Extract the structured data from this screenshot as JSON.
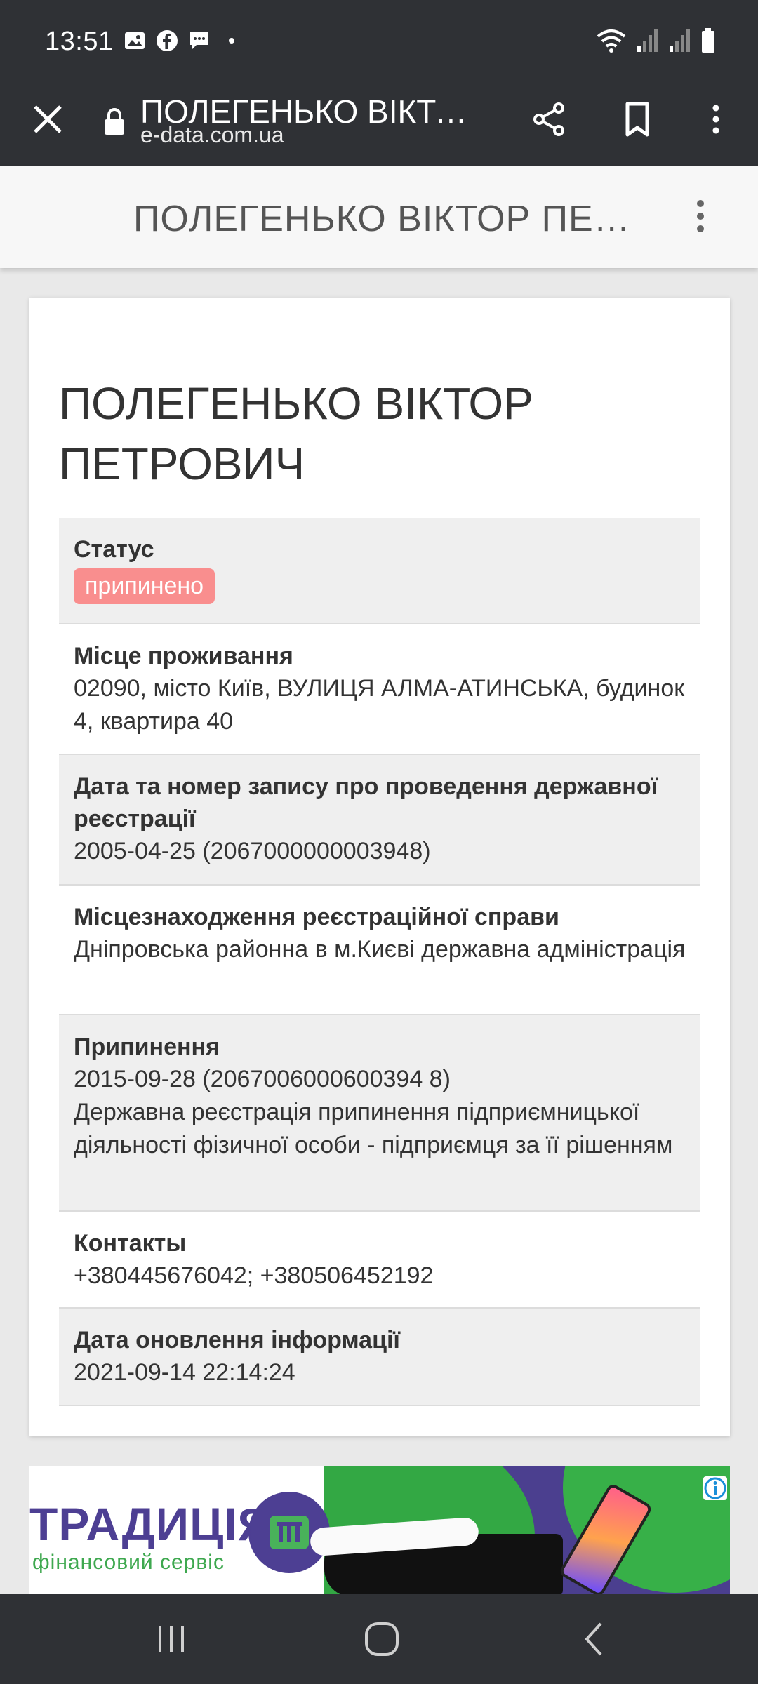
{
  "status_bar": {
    "time": "13:51",
    "left_icons": [
      "image-icon",
      "facebook-icon",
      "message-icon",
      "dot-icon"
    ],
    "right_icons": [
      "wifi-icon",
      "signal-icon",
      "signal-icon",
      "battery-icon"
    ]
  },
  "browser": {
    "page_title": "ПОЛЕГЕНЬКО ВІКТО...",
    "domain": "e-data.com.ua"
  },
  "header": {
    "title": "ПОЛЕГЕНЬКО ВІКТОР ПЕТ..."
  },
  "card": {
    "name_line1": "ПОЛЕГЕНЬКО ВІКТОР",
    "name_line2": "ПЕТРОВИЧ",
    "rows": [
      {
        "label": "Статус",
        "badge": "припинено"
      },
      {
        "label": "Місце проживання",
        "value": "02090, місто Київ, ВУЛИЦЯ АЛМА-АТИНСЬКА, будинок 4, квартира 40"
      },
      {
        "label": "Дата та номер запису про проведення державної реєстрації",
        "value": "2005-04-25 (2067000000003948)"
      },
      {
        "label": "Місцезнаходження реєстраційної справи",
        "value": "Дніпровська районна в м.Києві державна адміністрація"
      },
      {
        "label": "Припинення",
        "value": "2015-09-28 (2067006000600394 8)",
        "value2": "Державна реєстрація припинення підприємницької діяльності фізичної особи - підприємця за її рішенням"
      },
      {
        "label": "Контакты",
        "value": "+380445676042; +380506452192"
      },
      {
        "label": "Дата оновлення інформації",
        "value": "2021-09-14 22:14:24"
      }
    ]
  },
  "ad": {
    "brand": "ТРАДИЦІЯ",
    "subtitle": "фінансовий сервіс"
  },
  "colors": {
    "system_bar": "#2f3135",
    "badge": "#f98e8e",
    "row_shade": "#efefef"
  }
}
